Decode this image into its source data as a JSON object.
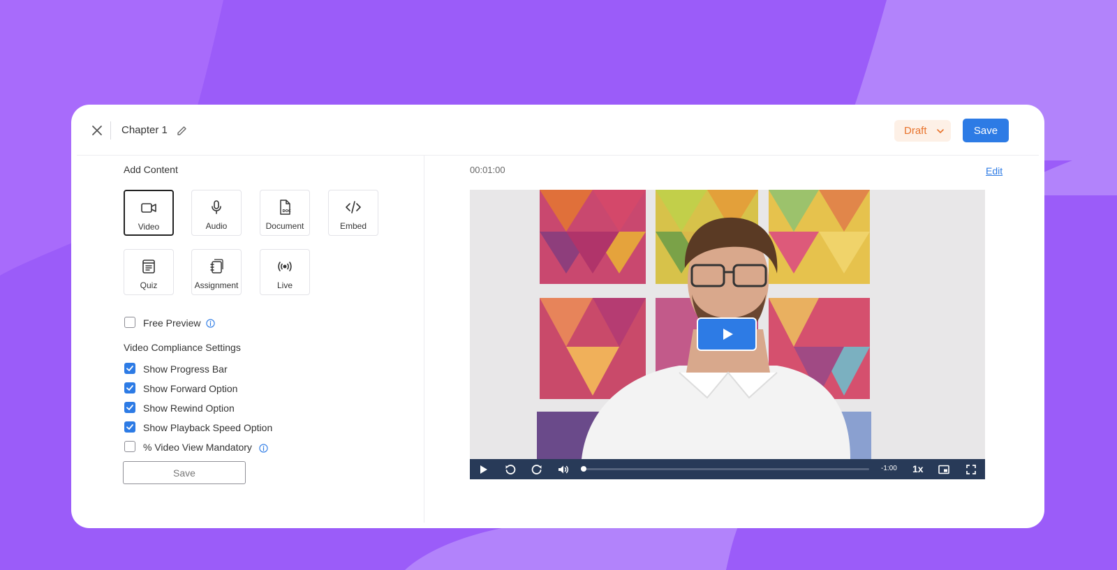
{
  "header": {
    "chapter_title": "Chapter 1",
    "status": "Draft",
    "save_label": "Save"
  },
  "content": {
    "section_title": "Add Content",
    "types": [
      "Video",
      "Audio",
      "Document",
      "Embed",
      "Quiz",
      "Assignment",
      "Live"
    ],
    "selected_type": "Video"
  },
  "free_preview": {
    "label": "Free Preview",
    "checked": false
  },
  "compliance": {
    "title": "Video Compliance Settings",
    "options": [
      {
        "label": "Show Progress Bar",
        "checked": true
      },
      {
        "label": "Show Forward Option",
        "checked": true
      },
      {
        "label": "Show Rewind Option",
        "checked": true
      },
      {
        "label": "Show Playback Speed Option",
        "checked": true
      },
      {
        "label": "% Video View Mandatory",
        "checked": false
      }
    ],
    "save_label": "Save"
  },
  "player": {
    "duration": "00:01:00",
    "edit_label": "Edit",
    "remaining": "-1:00",
    "speed": "1x",
    "progress": 0
  },
  "colors": {
    "accent": "#2d7be5",
    "draft_text": "#e8732c",
    "draft_bg": "#fdf0e6",
    "background": "#a86bfb",
    "controls_bg": "#283a58"
  },
  "icons": [
    "close-icon",
    "pencil-icon",
    "chevron-down-icon",
    "video-camera-icon",
    "microphone-icon",
    "document-icon",
    "code-icon",
    "quiz-icon",
    "assignment-icon",
    "broadcast-icon",
    "info-icon",
    "play-icon",
    "rewind-icon",
    "forward-icon",
    "volume-icon",
    "picture-in-picture-icon",
    "fullscreen-icon"
  ]
}
